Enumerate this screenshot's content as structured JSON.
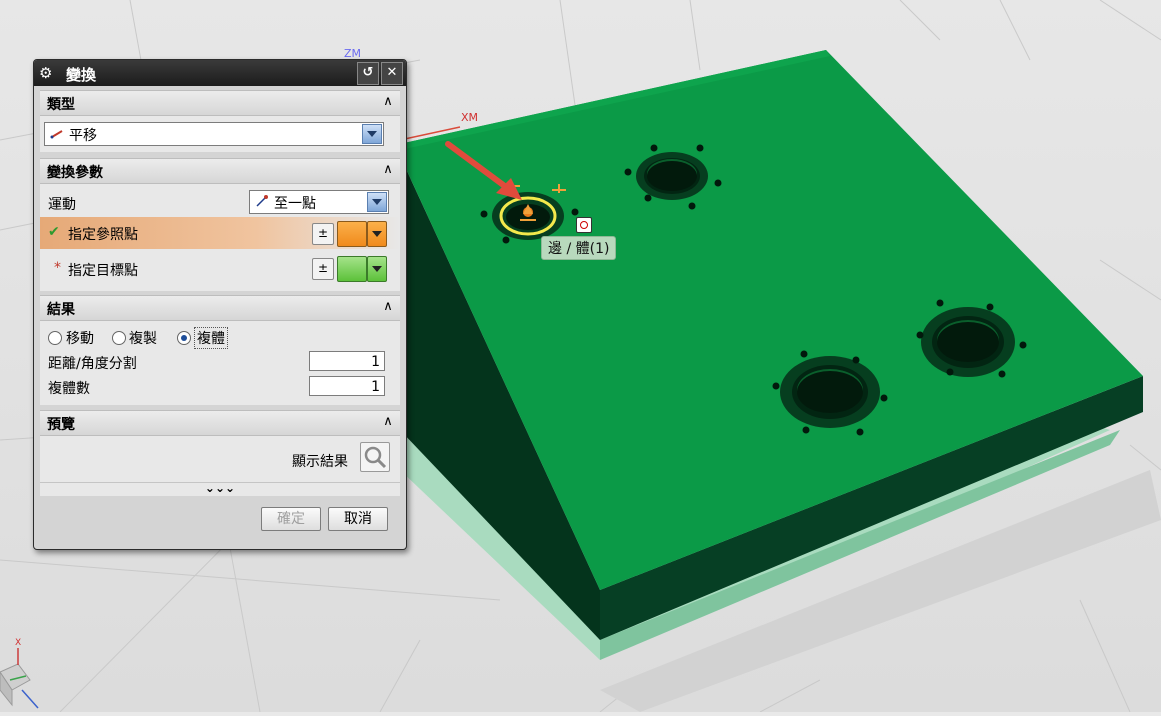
{
  "viewport": {
    "axis_labels": {
      "zm": "ZM",
      "xm": "XM",
      "x": "X"
    },
    "tooltip": "邊 / 體(1)",
    "colors": {
      "plate_top": "#0b9a47",
      "plate_side": "#063d22",
      "plate_base": "#9fd4b6",
      "background": "#e9e9e9",
      "arrow": "#e04b3c"
    }
  },
  "dialog": {
    "title": "變換",
    "reset_icon": "reset-icon",
    "close_icon": "close-icon",
    "type_section": {
      "header": "類型",
      "selected": "平移"
    },
    "params_section": {
      "header": "變換參數",
      "motion_label": "運動",
      "motion_value": "至一點",
      "ref_point_label": "指定參照點",
      "target_point_label": "指定目標點",
      "required_marker": "*",
      "check_marker": "✔"
    },
    "result_section": {
      "header": "結果",
      "options": [
        "移動",
        "複製",
        "複體"
      ],
      "selected_option": "複體",
      "distance_label": "距離/角度分割",
      "distance_value": "1",
      "copies_label": "複體數",
      "copies_value": "1"
    },
    "preview_section": {
      "header": "預覽",
      "show_result_label": "顯示結果"
    },
    "more_indicator": "⌄⌄⌄",
    "ok_label": "確定",
    "cancel_label": "取消"
  }
}
